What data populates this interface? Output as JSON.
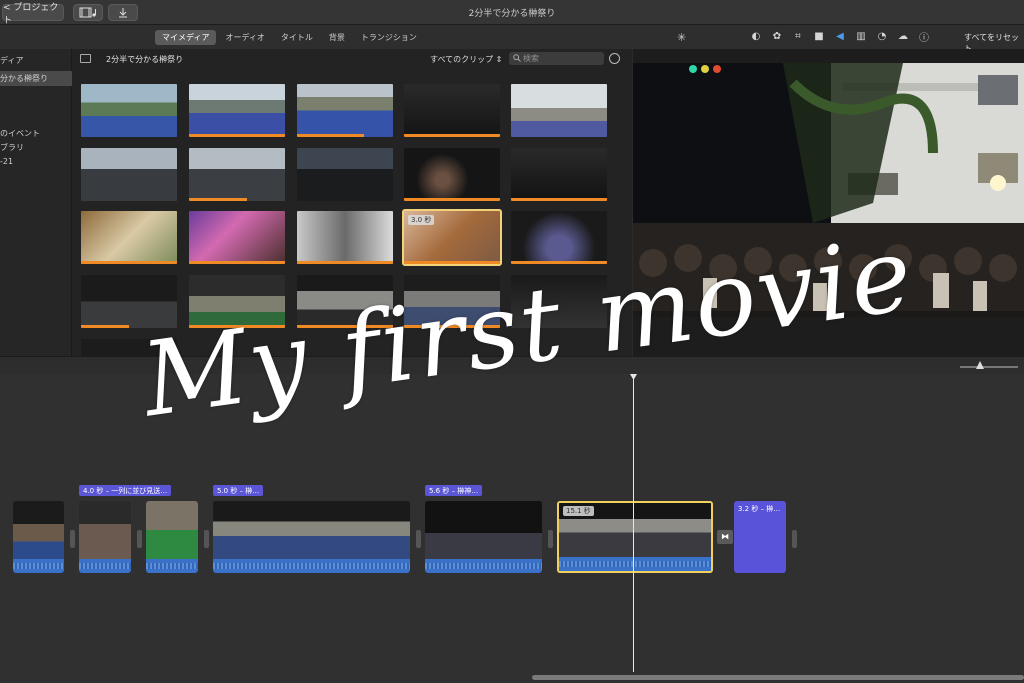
{
  "topbar": {
    "back_label": "< プロジェクト",
    "title": "2分半で分かる榊祭り"
  },
  "tabs": [
    "マイメディア",
    "オーディオ",
    "タイトル",
    "背景",
    "トランジション"
  ],
  "tools": {
    "reset_label": "すべてをリセット"
  },
  "sidebar": {
    "items": [
      "ディア",
      "分かる榊祭り",
      "のイベント",
      "ブラリ",
      "-21"
    ]
  },
  "browser": {
    "title": "2分半で分かる榊祭り",
    "filter_label": "すべてのクリップ ⇕",
    "search_placeholder": "検索",
    "selected_badge": "3.0 秒"
  },
  "timeline": {
    "labels": [
      "4.0 秒 – 一列に並び見送…",
      "5.0 秒 – 榊…",
      "5.6 秒 – 榊神…"
    ],
    "selected_badge": "15.1 秒",
    "title_clip_label": "3.2 秒 – 榊…"
  },
  "overlay": {
    "text": "My first movie"
  },
  "colors": {
    "accent_orange": "#f08a24",
    "clip_purple": "#5b56d6",
    "audio_blue": "#3a72c9",
    "selection_yellow": "#f1d15d"
  }
}
